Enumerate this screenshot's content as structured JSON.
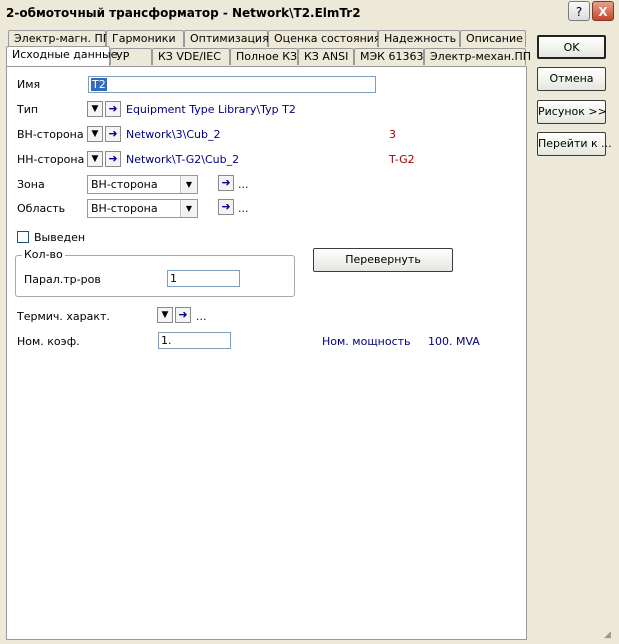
{
  "window": {
    "title": "2-обмоточный трансформатор - Network\\T2.ElmTr2",
    "help_button": "?",
    "close_button": "X"
  },
  "tabs_row1": [
    "Электр-магн. ПП",
    "Гармоники",
    "Оптимизация",
    "Оценка состояния",
    "Надежность",
    "Описание"
  ],
  "tabs_row2": [
    "Исходные данные",
    "УР",
    "КЗ VDE/IEC",
    "Полное КЗ",
    "КЗ ANSI",
    "МЭК 61363",
    "Электр-механ.ПП"
  ],
  "form": {
    "name_label": "Имя",
    "name_value": "T2",
    "type_label": "Тип",
    "type_link": "Equipment Type Library\\Typ T2",
    "hv_label": "ВН-сторона",
    "hv_link": "Network\\3\\Cub_2",
    "hv_node": "3",
    "lv_label": "НН-сторона",
    "lv_link": "Network\\T-G2\\Cub_2",
    "lv_node": "T-G2",
    "zone_label": "Зона",
    "zone_value": "ВН-сторона",
    "zone_dots": "...",
    "area_label": "Область",
    "area_value": "ВН-сторона",
    "area_dots": "...",
    "out_of_service_label": "Выведен",
    "group_label": "Кол-во",
    "parallel_label": "Парал.тр-ров",
    "parallel_value": "1",
    "flip_button": "Перевернуть",
    "thermal_label": "Термич. характ.",
    "thermal_dots": "...",
    "rating_factor_label": "Ном. коэф.",
    "rating_factor_value": "1.",
    "rated_power_label": "Ном. мощность",
    "rated_power_value": "100. MVA"
  },
  "side_buttons": {
    "ok": "OK",
    "cancel": "Отмена",
    "figure": "Рисунок >>",
    "jump": "Перейти к ..."
  }
}
